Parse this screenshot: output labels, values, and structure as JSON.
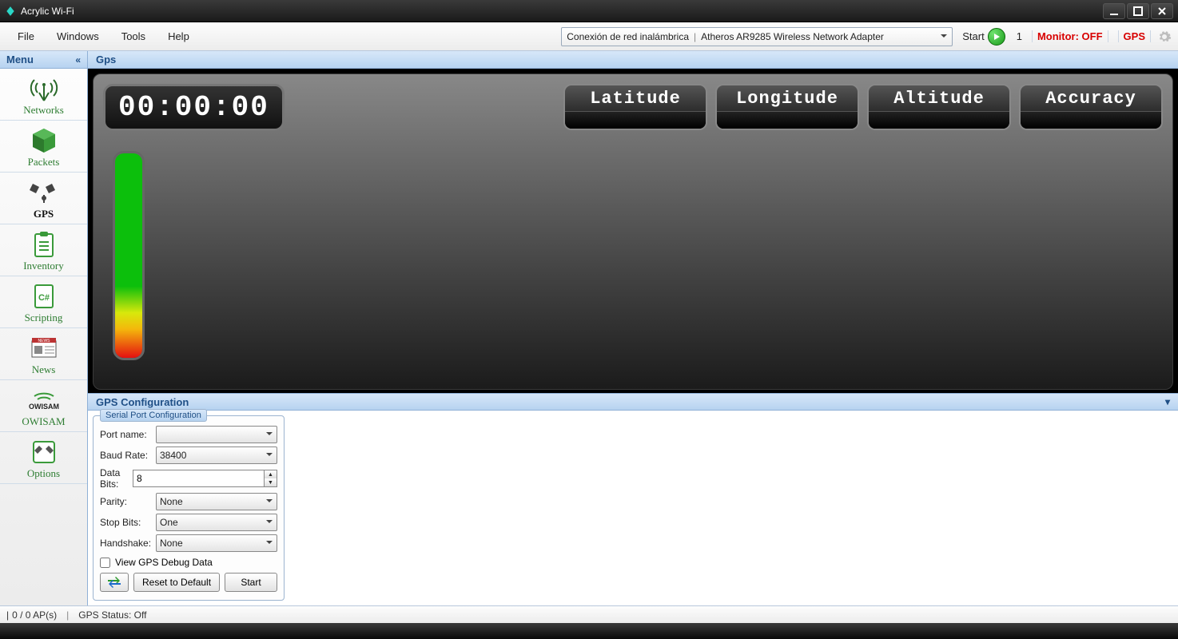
{
  "window": {
    "title": "Acrylic Wi-Fi"
  },
  "menubar": {
    "items": [
      "File",
      "Windows",
      "Tools",
      "Help"
    ],
    "adapter_left": "Conexión de red inalámbrica",
    "adapter_right": "Atheros AR9285 Wireless Network Adapter",
    "start_label": "Start",
    "count": "1",
    "monitor": "Monitor: OFF",
    "gps": "GPS"
  },
  "headstrip": {
    "menu": "Menu",
    "collapse": "«",
    "gps": "Gps"
  },
  "sidebar": {
    "items": [
      {
        "label": "Networks"
      },
      {
        "label": "Packets"
      },
      {
        "label": "GPS"
      },
      {
        "label": "Inventory"
      },
      {
        "label": "Scripting"
      },
      {
        "label": "News"
      },
      {
        "label": "OWISAM"
      },
      {
        "label": "Options"
      }
    ]
  },
  "gps": {
    "timer": "00:00:00",
    "coords": [
      "Latitude",
      "Longitude",
      "Altitude",
      "Accuracy"
    ]
  },
  "config": {
    "header": "GPS Configuration",
    "legend": "Serial Port Configuration",
    "fields": {
      "port_name": {
        "label": "Port name:",
        "value": ""
      },
      "baud_rate": {
        "label": "Baud Rate:",
        "value": "38400"
      },
      "data_bits": {
        "label": "Data Bits:",
        "value": "8"
      },
      "parity": {
        "label": "Parity:",
        "value": "None"
      },
      "stop_bits": {
        "label": "Stop Bits:",
        "value": "One"
      },
      "handshake": {
        "label": "Handshake:",
        "value": "None"
      }
    },
    "debug_label": "View GPS Debug Data",
    "reset_label": "Reset to Default",
    "start_label": "Start"
  },
  "status": {
    "aps": "0 / 0 AP(s)",
    "gps": "GPS Status: Off"
  }
}
